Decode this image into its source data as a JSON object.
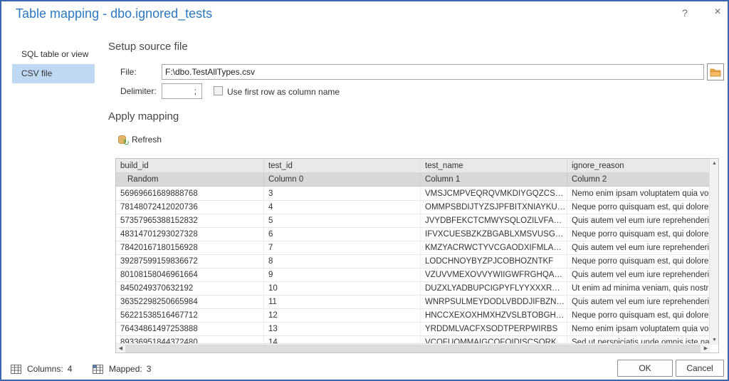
{
  "dialog": {
    "title": "Table mapping - dbo.ignored_tests",
    "help_glyph": "?",
    "close_glyph": "×"
  },
  "sidebar": {
    "items": [
      {
        "label": "SQL table or view",
        "selected": false
      },
      {
        "label": "CSV file",
        "selected": true
      }
    ]
  },
  "setup": {
    "heading": "Setup source file",
    "file_label": "File:",
    "file_value": "F:\\dbo.TestAllTypes.csv",
    "delimiter_label": "Delimiter:",
    "delimiter_value": ";",
    "first_row_label": "Use first row as column name",
    "first_row_checked": false
  },
  "mapping": {
    "heading": "Apply mapping",
    "refresh_label": "Refresh",
    "refresh_arrow_glyph": "↻"
  },
  "grid": {
    "columns": [
      "build_id",
      "test_id",
      "test_name",
      "ignore_reason"
    ],
    "mapping_row": [
      "Random",
      "Column 0",
      "Column 1",
      "Column 2"
    ],
    "rows": [
      [
        "56969661689888768",
        "3",
        "VMSJCMPVEQRQVMKDIYGQZCSPVQBIQP...",
        "Nemo enim ipsam voluptatem quia volup"
      ],
      [
        "78148072412020736",
        "4",
        "OMMPSBDIJTYZSJPFBITXNIAYKUKZOABSW...",
        "Neque porro quisquam est, qui dolorem"
      ],
      [
        "57357965388152832",
        "5",
        "JVYDBFEKCTCMWYSQLOZILVFAQVWFHQEI...",
        "Quis autem vel eum iure reprehenderit q"
      ],
      [
        "48314701293027328",
        "6",
        "IFVXCUESBZKZBGABLXMSVUSGQJYGCIDQ...",
        "Neque porro quisquam est, qui dolorem"
      ],
      [
        "78420167180156928",
        "7",
        "KMZYACRWCTYVCGAODXIFMLAAUSGJVB...",
        "Quis autem vel eum iure reprehenderit q"
      ],
      [
        "39287599159836672",
        "8",
        "LODCHNOYBYZPJCOBHOZNTKF",
        "Neque porro quisquam est, qui dolorem"
      ],
      [
        "80108158046961664",
        "9",
        "VZUVVMEXOVVYWIIGWFRGHQARRYWCV...",
        "Quis autem vel eum iure reprehenderit q"
      ],
      [
        "8450249370632192",
        "10",
        "DUZXLYADBUPCIGPYFLYYXXXRWMZKVCJBF...",
        "Ut enim ad minima veniam, quis nostrum"
      ],
      [
        "36352298250665984",
        "11",
        "WNRPSULMEYDODLVBDDJIFBZNGQSOQE...",
        "Quis autem vel eum iure reprehenderit q"
      ],
      [
        "56221538516467712",
        "12",
        "HNCCXEXOXHMXHZVSLBTOBGHFZBUOG...",
        "Neque porro quisquam est, qui dolorem"
      ],
      [
        "76434861497253888",
        "13",
        "YRDDMLVACFXSODTPERPWIRBS",
        "Nemo enim ipsam voluptatem quia volup"
      ],
      [
        "89336951844372480",
        "14",
        "VCOFUOMMAIGCOFOIDISCSORKBOCYU...",
        "Sed ut perspiciatis unde omnis iste natu"
      ]
    ],
    "scroll_glyphs": {
      "up": "▲",
      "down": "▼",
      "left": "◀",
      "right": "▶"
    }
  },
  "status_bar": {
    "columns_label": "Columns:",
    "columns_value": "4",
    "mapped_label": "Mapped:",
    "mapped_value": "3"
  },
  "footer": {
    "ok_label": "OK",
    "cancel_label": "Cancel"
  },
  "colors": {
    "dialog_border": "#3a68b0",
    "title_text": "#2b79c2",
    "sidebar_selected_bg": "#bfd8f4",
    "grid_header_bg": "#e9e9e9",
    "grid_mapping_bg": "#d8d8d8",
    "folder_icon": "#eda63f",
    "refresh_arrow": "#3f9e3f"
  }
}
